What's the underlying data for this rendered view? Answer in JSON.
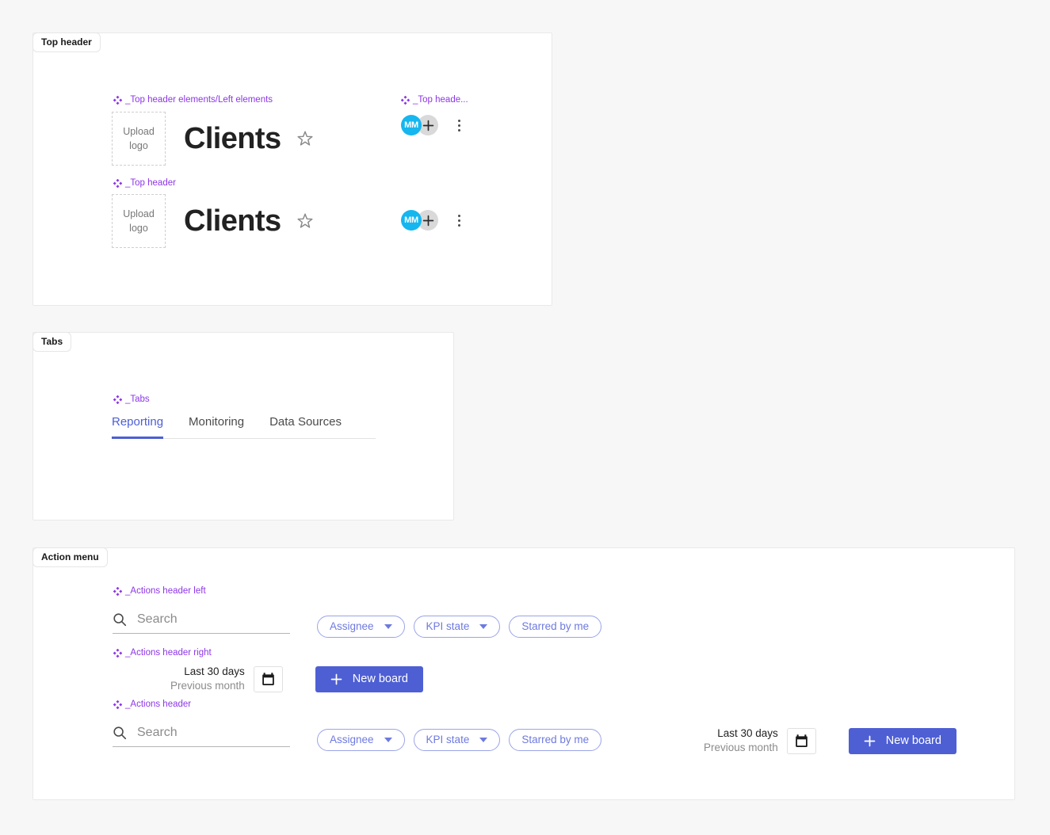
{
  "canvas": {
    "background": "#f7f7f7",
    "accent_purple": "#8c36e8",
    "accent_indigo": "#4e5fd4",
    "avatar_color": "#16b6ef"
  },
  "frames": {
    "top_header": {
      "label": "Top header"
    },
    "tabs": {
      "label": "Tabs"
    },
    "action_menu": {
      "label": "Action menu"
    }
  },
  "instances": {
    "left_elements": "_Top header elements/Left elements",
    "right_elements": "_Top heade...",
    "top_header": "_Top header",
    "tabs": "_Tabs",
    "actions_header_left": "_Actions header left",
    "actions_header_right": "_Actions header right",
    "actions_header": "_Actions header"
  },
  "header": {
    "upload_logo_line1": "Upload",
    "upload_logo_line2": "logo",
    "title": "Clients",
    "star_icon": "star-outline-icon",
    "avatar_initials": "MM",
    "add_icon": "plus-icon",
    "more_icon": "kebab-menu-icon"
  },
  "tabs": {
    "items": [
      {
        "label": "Reporting",
        "active": true
      },
      {
        "label": "Monitoring",
        "active": false
      },
      {
        "label": "Data Sources",
        "active": false
      }
    ]
  },
  "actions": {
    "search_placeholder": "Search",
    "search_icon": "search-icon",
    "chips": [
      {
        "label": "Assignee",
        "has_caret": true
      },
      {
        "label": "KPI state",
        "has_caret": true
      },
      {
        "label": "Starred by me",
        "has_caret": false
      }
    ],
    "date_range_primary": "Last 30 days",
    "date_range_secondary": "Previous month",
    "calendar_icon": "calendar-icon",
    "new_board_label": "New board",
    "new_board_icon": "plus-icon"
  }
}
